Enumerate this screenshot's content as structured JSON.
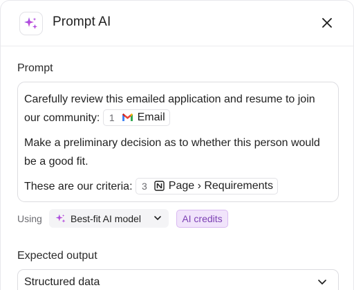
{
  "header": {
    "title": "Prompt AI",
    "icon": "sparkles-icon",
    "accent": "#c04be0"
  },
  "prompt_section": {
    "label": "Prompt",
    "paragraph1": {
      "text_a": "Carefully review this emailed application and resume to join our community:",
      "chip": {
        "number": "1",
        "icon": "gmail-icon",
        "label": "Email"
      }
    },
    "paragraph2": {
      "text": "Make a preliminary decision as to whether this person would be a good fit."
    },
    "paragraph3": {
      "text": "These are our criteria:",
      "chip": {
        "number": "3",
        "icon": "notion-icon",
        "label": "Page › Requirements"
      }
    }
  },
  "model_row": {
    "using_label": "Using",
    "model_label": "Best-fit AI model",
    "credits_label": "AI credits",
    "credits_bg": "#f1e4fb",
    "credits_color": "#7b3fb3"
  },
  "output_section": {
    "label": "Expected output",
    "selected_value": "Structured data"
  }
}
